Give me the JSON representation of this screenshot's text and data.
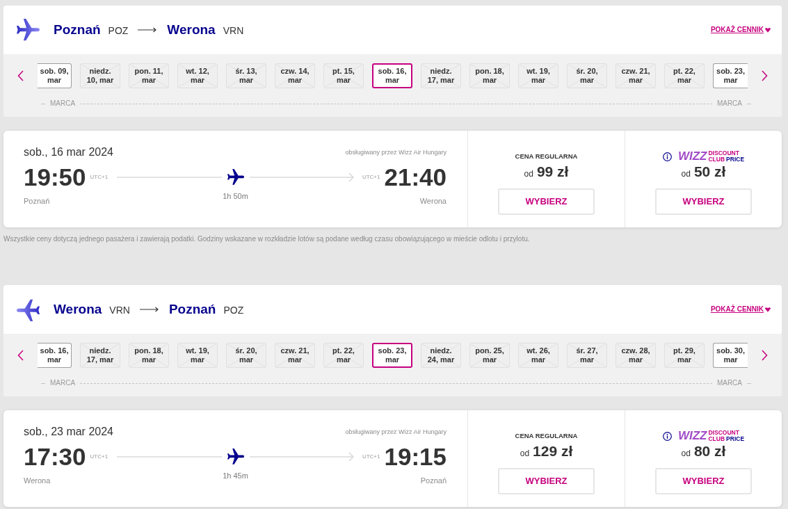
{
  "segments": [
    {
      "kind": "outbound",
      "origin": {
        "city": "Poznań",
        "code": "POZ"
      },
      "destination": {
        "city": "Werona",
        "code": "VRN"
      },
      "price_list_link": "POKAŻ CENNIK",
      "dates": [
        {
          "label": "sob. 09, mar",
          "selected": false,
          "disabled": false
        },
        {
          "label": "niedz. 10, mar",
          "selected": false,
          "disabled": true
        },
        {
          "label": "pon. 11, mar",
          "selected": false,
          "disabled": true
        },
        {
          "label": "wt. 12, mar",
          "selected": false,
          "disabled": true
        },
        {
          "label": "śr. 13, mar",
          "selected": false,
          "disabled": true
        },
        {
          "label": "czw. 14, mar",
          "selected": false,
          "disabled": true
        },
        {
          "label": "pt. 15, mar",
          "selected": false,
          "disabled": true
        },
        {
          "label": "sob. 16, mar",
          "selected": true,
          "disabled": false
        },
        {
          "label": "niedz. 17, mar",
          "selected": false,
          "disabled": true
        },
        {
          "label": "pon. 18, mar",
          "selected": false,
          "disabled": true
        },
        {
          "label": "wt. 19, mar",
          "selected": false,
          "disabled": true
        },
        {
          "label": "śr. 20, mar",
          "selected": false,
          "disabled": true
        },
        {
          "label": "czw. 21, mar",
          "selected": false,
          "disabled": true
        },
        {
          "label": "pt. 22, mar",
          "selected": false,
          "disabled": true
        },
        {
          "label": "sob. 23, mar",
          "selected": false,
          "disabled": false
        }
      ],
      "month_labels": [
        "MARCA",
        "MARCA"
      ],
      "flight": {
        "date": "sob., 16 mar 2024",
        "operator": "obsługiwany przez Wizz Air Hungary",
        "departure": {
          "time": "19:50",
          "timezone": "UTC+1",
          "city": "Poznań"
        },
        "arrival": {
          "time": "21:40",
          "timezone": "UTC+1",
          "city": "Werona"
        },
        "duration": "1h 50m",
        "fares": [
          {
            "kind": "regular",
            "title": "CENA REGULARNA",
            "prefix": "od",
            "price": "99 zł",
            "button": "WYBIERZ"
          },
          {
            "kind": "club",
            "logo": {
              "brand": "WIZZ",
              "discount": "DISCOUNT",
              "club": "CLUB",
              "price": "PRICE"
            },
            "prefix": "od",
            "price": "50 zł",
            "button": "WYBIERZ"
          }
        ]
      },
      "note": "Wszystkie ceny dotyczą jednego pasażera i zawierają podatki. Godziny wskazane w rozkładzie lotów są podane według czasu obowiązującego w mieście odlotu i przylotu."
    },
    {
      "kind": "return",
      "origin": {
        "city": "Werona",
        "code": "VRN"
      },
      "destination": {
        "city": "Poznań",
        "code": "POZ"
      },
      "price_list_link": "POKAŻ CENNIK",
      "dates": [
        {
          "label": "sob. 16, mar",
          "selected": false,
          "disabled": false
        },
        {
          "label": "niedz. 17, mar",
          "selected": false,
          "disabled": true
        },
        {
          "label": "pon. 18, mar",
          "selected": false,
          "disabled": true
        },
        {
          "label": "wt. 19, mar",
          "selected": false,
          "disabled": true
        },
        {
          "label": "śr. 20, mar",
          "selected": false,
          "disabled": true
        },
        {
          "label": "czw. 21, mar",
          "selected": false,
          "disabled": true
        },
        {
          "label": "pt. 22, mar",
          "selected": false,
          "disabled": true
        },
        {
          "label": "sob. 23, mar",
          "selected": true,
          "disabled": false
        },
        {
          "label": "niedz. 24, mar",
          "selected": false,
          "disabled": true
        },
        {
          "label": "pon. 25, mar",
          "selected": false,
          "disabled": true
        },
        {
          "label": "wt. 26, mar",
          "selected": false,
          "disabled": true
        },
        {
          "label": "śr. 27, mar",
          "selected": false,
          "disabled": true
        },
        {
          "label": "czw. 28, mar",
          "selected": false,
          "disabled": true
        },
        {
          "label": "pt. 29, mar",
          "selected": false,
          "disabled": true
        },
        {
          "label": "sob. 30, mar",
          "selected": false,
          "disabled": false
        }
      ],
      "month_labels": [
        "MARCA",
        "MARCA"
      ],
      "flight": {
        "date": "sob., 23 mar 2024",
        "operator": "obsługiwany przez Wizz Air Hungary",
        "departure": {
          "time": "17:30",
          "timezone": "UTC+1",
          "city": "Werona"
        },
        "arrival": {
          "time": "19:15",
          "timezone": "UTC+1",
          "city": "Poznań"
        },
        "duration": "1h 45m",
        "fares": [
          {
            "kind": "regular",
            "title": "CENA REGULARNA",
            "prefix": "od",
            "price": "129 zł",
            "button": "WYBIERZ"
          },
          {
            "kind": "club",
            "logo": {
              "brand": "WIZZ",
              "discount": "DISCOUNT",
              "club": "CLUB",
              "price": "PRICE"
            },
            "prefix": "od",
            "price": "80 zł",
            "button": "WYBIERZ"
          }
        ]
      }
    }
  ]
}
